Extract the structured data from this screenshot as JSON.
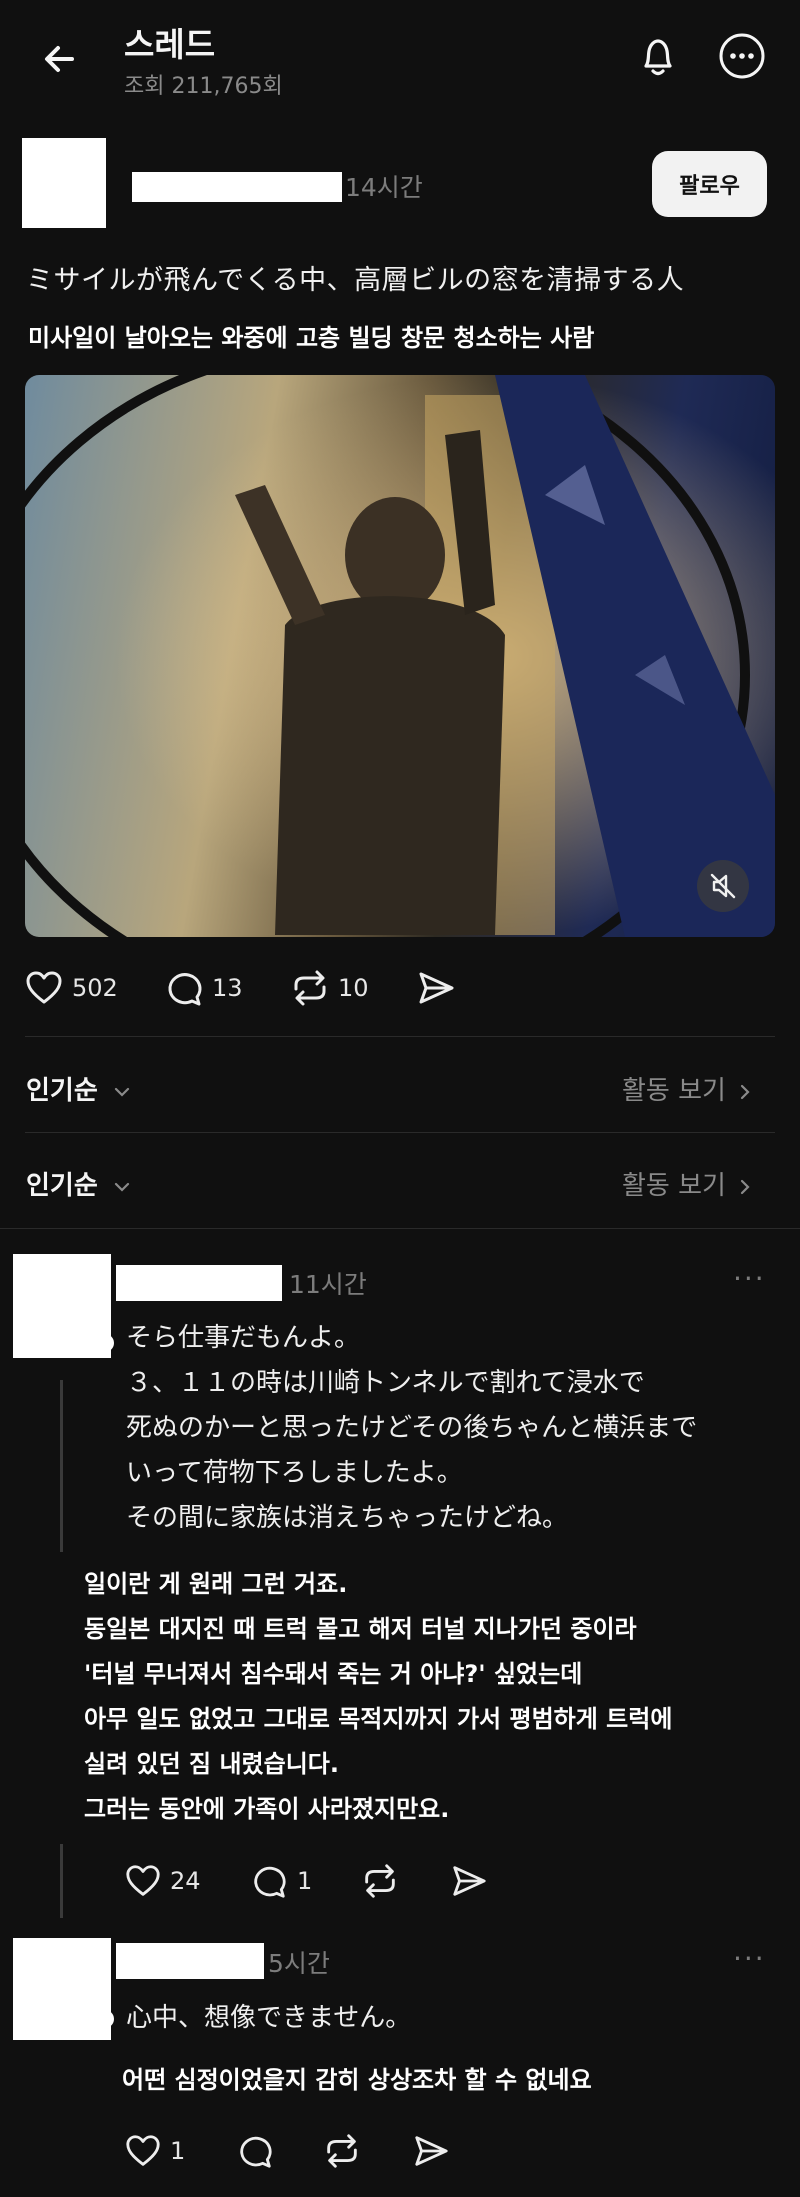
{
  "header": {
    "title": "스레드",
    "views": "조회 211,765회"
  },
  "post": {
    "time": "14시간",
    "follow_label": "팔로우",
    "text_jp": "ミサイルが飛んでくる中、高層ビルの窓を清掃する人",
    "text_ko": "미사일이 날아오는 와중에 고층 빌딩 창문 청소하는 사람",
    "likes": "502",
    "comments": "13",
    "reposts": "10"
  },
  "sort_rows": [
    {
      "sort_label": "인기순",
      "activity_label": "활동 보기"
    },
    {
      "sort_label": "인기순",
      "activity_label": "활동 보기"
    }
  ],
  "reply1": {
    "time": "11시간",
    "jp_lines": [
      "そら仕事だもんよ。",
      "３、１１の時は川崎トンネルで割れて浸水で",
      "死ぬのかーと思ったけどその後ちゃんと横浜まで",
      "いって荷物下ろしましたよ。",
      "その間に家族は消えちゃったけどね。"
    ],
    "ko_lines": [
      "일이란 게 원래 그런 거죠.",
      "동일본 대지진 때 트럭 몰고 해저 터널 지나가던 중이라",
      "'터널 무너져서 침수돼서 죽는 거 아냐?' 싶었는데",
      "아무 일도 없었고 그대로 목적지까지 가서 평범하게 트럭에",
      "실려 있던 짐 내렸습니다.",
      "그러는 동안에 가족이 사라졌지만요."
    ],
    "likes": "24",
    "comments": "1"
  },
  "reply2": {
    "time": "5시간",
    "jp_line": "心中、想像できません。",
    "ko_line": "어떤 심정이었을지 감히 상상조차 할 수 없네요",
    "likes": "1"
  },
  "icons": {
    "back": "arrow-left-icon",
    "bell": "bell-icon",
    "more": "more-circle-icon",
    "like": "heart-icon",
    "comment": "comment-icon",
    "repost": "repost-icon",
    "share": "send-icon",
    "mute": "muted-speaker-icon",
    "chevron": "chevron-icon"
  }
}
